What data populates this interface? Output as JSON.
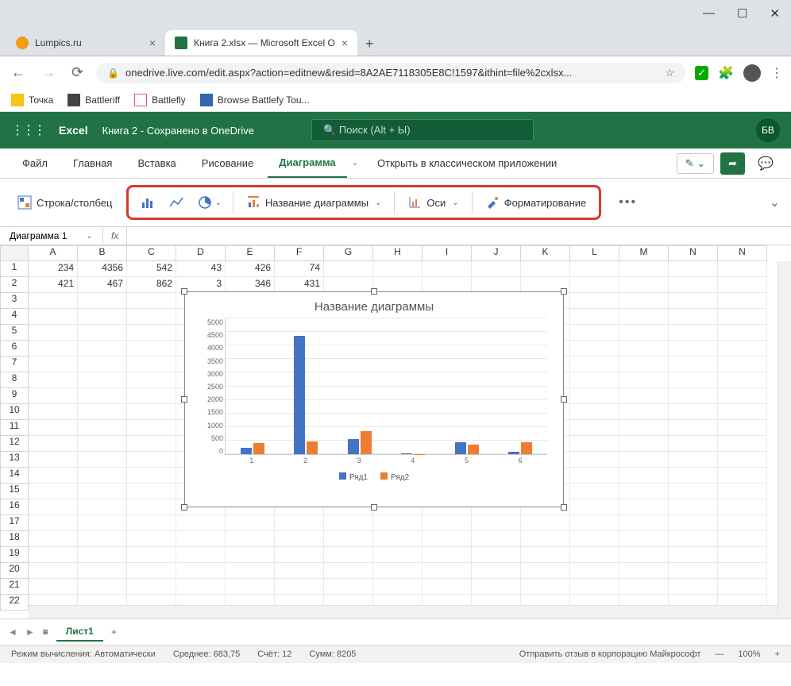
{
  "browser": {
    "tabs": [
      {
        "title": "Lumpics.ru",
        "favicon": "#f39c12"
      },
      {
        "title": "Книга 2.xlsx — Microsoft Excel O",
        "favicon": "#217346"
      }
    ],
    "url": "onedrive.live.com/edit.aspx?action=editnew&resid=8A2AE7118305E8C!1597&ithint=file%2cxlsx...",
    "bookmarks": [
      {
        "label": "Точка",
        "color": "#f5c518"
      },
      {
        "label": "Battleriff",
        "color": "#555"
      },
      {
        "label": "Battlefly",
        "color": "#e84f8a"
      },
      {
        "label": "Browse Battlefy Tou...",
        "color": "#6b5"
      }
    ]
  },
  "excel": {
    "app": "Excel",
    "doc_name": "Книга 2",
    "save_status": "Сохранено в OneDrive",
    "search_placeholder": "Поиск (Alt + Ы)",
    "avatar": "БВ",
    "ribbon_tabs": [
      "Файл",
      "Главная",
      "Вставка",
      "Рисование",
      "Диаграмма"
    ],
    "open_desktop": "Открыть в классическом приложении",
    "toolbar": {
      "row_col": "Строка/столбец",
      "chart_title": "Название диаграммы",
      "axes": "Оси",
      "formatting": "Форматирование"
    },
    "namebox": "Диаграмма 1",
    "columns": [
      "A",
      "B",
      "C",
      "D",
      "E",
      "F",
      "G",
      "H",
      "I",
      "J",
      "K",
      "L",
      "M",
      "N",
      "N"
    ],
    "data_rows": [
      [
        "234",
        "4356",
        "542",
        "43",
        "426",
        "74"
      ],
      [
        "421",
        "467",
        "862",
        "3",
        "346",
        "431"
      ]
    ],
    "sheet": "Лист1",
    "status": {
      "mode_label": "Режим вычисления:",
      "mode_value": "Автоматически",
      "avg_label": "Среднее:",
      "avg": "683,75",
      "count_label": "Счёт:",
      "count": "12",
      "sum_label": "Сумм:",
      "sum": "8205",
      "feedback": "Отправить отзыв в корпорацию Майкрософт",
      "zoom": "100%"
    }
  },
  "chart_data": {
    "type": "bar",
    "title": "Название диаграммы",
    "categories": [
      "1",
      "2",
      "3",
      "4",
      "5",
      "6"
    ],
    "series": [
      {
        "name": "Ряд1",
        "color": "#4472c4",
        "values": [
          234,
          4356,
          542,
          43,
          426,
          74
        ]
      },
      {
        "name": "Ряд2",
        "color": "#ed7d31",
        "values": [
          421,
          467,
          862,
          3,
          346,
          431
        ]
      }
    ],
    "y_ticks": [
      0,
      500,
      1000,
      1500,
      2000,
      2500,
      3000,
      3500,
      4000,
      4500,
      5000
    ],
    "ylim": [
      0,
      5000
    ],
    "xlabel": "",
    "ylabel": ""
  }
}
